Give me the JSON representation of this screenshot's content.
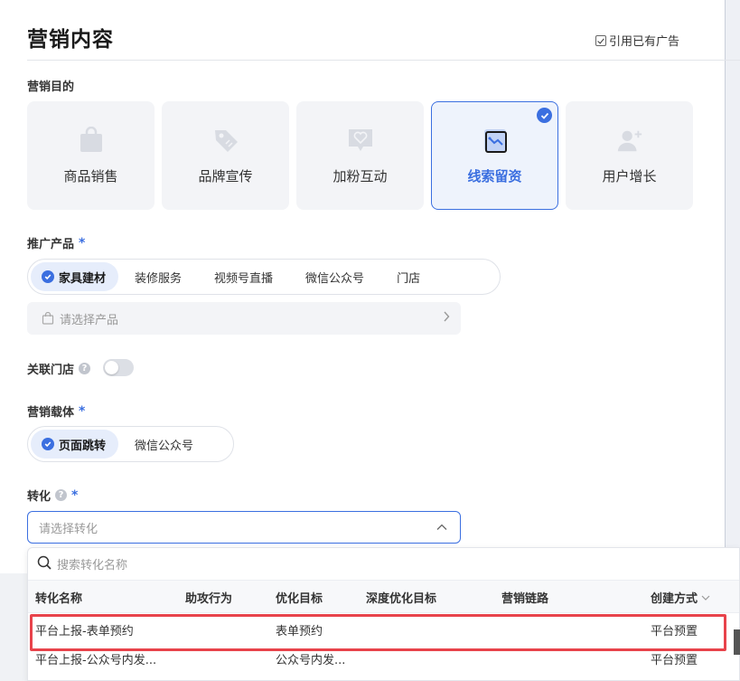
{
  "header": {
    "title": "营销内容",
    "ref_ad": "引用已有广告"
  },
  "goal_section": {
    "label": "营销目的",
    "items": [
      {
        "label": "商品销售",
        "icon": "shopping-bag-icon",
        "active": false
      },
      {
        "label": "品牌宣传",
        "icon": "tag-icon",
        "active": false
      },
      {
        "label": "加粉互动",
        "icon": "heart-chat-icon",
        "active": false
      },
      {
        "label": "线索留资",
        "icon": "lead-form-icon",
        "active": true
      },
      {
        "label": "用户增长",
        "icon": "user-add-icon",
        "active": false
      }
    ]
  },
  "product_section": {
    "label": "推广产品",
    "required": "*",
    "options": [
      "家具建材",
      "装修服务",
      "视频号直播",
      "微信公众号",
      "门店"
    ],
    "selected": "家具建材",
    "select_placeholder": "请选择产品"
  },
  "store_section": {
    "label": "关联门店",
    "help": "?"
  },
  "carrier_section": {
    "label": "营销载体",
    "required": "*",
    "options": [
      "页面跳转",
      "微信公众号"
    ],
    "selected": "页面跳转"
  },
  "conversion_section": {
    "label": "转化",
    "help": "?",
    "required": "*",
    "placeholder": "请选择转化"
  },
  "dropdown": {
    "search_placeholder": "搜索转化名称",
    "columns": [
      "转化名称",
      "助攻行为",
      "优化目标",
      "深度优化目标",
      "营销链路",
      "创建方式"
    ],
    "rows": [
      [
        "平台上报-表单预约",
        "",
        "表单预约",
        "",
        "",
        "平台预置"
      ],
      [
        "平台上报-公众号内发...",
        "",
        "公众号内发...",
        "",
        "",
        "平台预置"
      ]
    ]
  },
  "colors": {
    "accent": "#3b6fe0",
    "highlight": "#e8434b"
  }
}
